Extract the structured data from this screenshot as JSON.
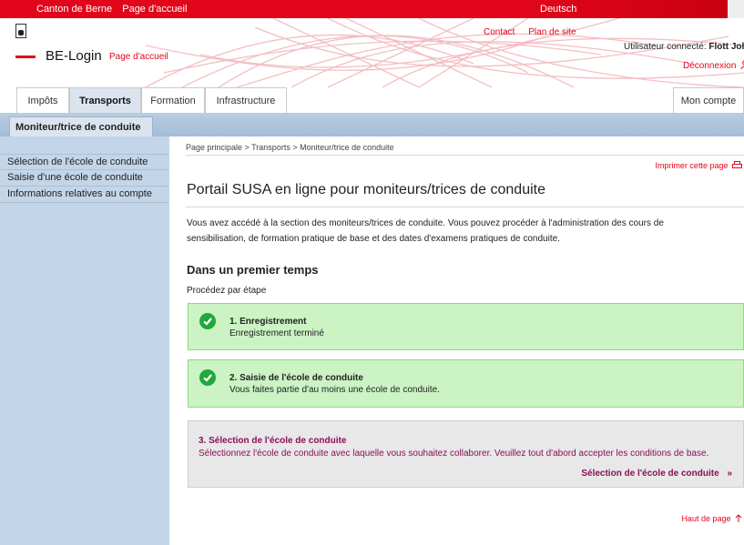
{
  "topbar": {
    "canton": "Canton de Berne",
    "home": "Page d'accueil",
    "language": "Deutsch"
  },
  "header": {
    "app_name": "BE-Login",
    "home_link": "Page d'accueil",
    "contact": "Contact",
    "sitemap": "Plan de site",
    "user_label": "Utilisateur connecté:",
    "user_name": "Flott John",
    "logout": "Déconnexion"
  },
  "tabs": [
    {
      "label": "Impôts"
    },
    {
      "label": "Transports"
    },
    {
      "label": "Formation"
    },
    {
      "label": "Infrastructure"
    },
    {
      "label": "Mon compte"
    }
  ],
  "subtab": {
    "label": "Moniteur/trice de conduite"
  },
  "sidebar": {
    "items": [
      {
        "label": "Sélection de l'école de conduite"
      },
      {
        "label": "Saisie d'une école de conduite"
      },
      {
        "label": "Informations relatives au compte"
      }
    ]
  },
  "main": {
    "breadcrumb": "Page principale > Transports > Moniteur/trice de conduite",
    "print": "Imprimer cette page",
    "title": "Portail SUSA en ligne pour moniteurs/trices de conduite",
    "intro": "Vous avez accédé à la section des moniteurs/trices de conduite. Vous pouvez procéder à l'administration des cours de sensibilisation, de formation pratique de base et des dates d'examens pratiques de conduite.",
    "heading": "Dans un premier temps",
    "step_label": "Procédez par étape",
    "steps": [
      {
        "title": "1. Enregistrement",
        "desc": "Enregistrement terminé"
      },
      {
        "title": "2. Saisie de l'école de conduite",
        "desc": "Vous faites partie d'au moins une école de conduite."
      },
      {
        "title": "3. Sélection de l'école de conduite",
        "desc": "Sélectionnez l'école de conduite avec laquelle vous souhaitez collaborer. Veuillez tout d'abord accepter les conditions de base.",
        "link": "Sélection de l'école de conduite",
        "link_arrow": "»"
      }
    ],
    "top_link": "Haut de page"
  },
  "colors": {
    "brand_red": "#e2061a",
    "nav_blue": "#c3d5e8",
    "success_green": "#cbf3c4",
    "link_purple": "#8b0e5a"
  }
}
